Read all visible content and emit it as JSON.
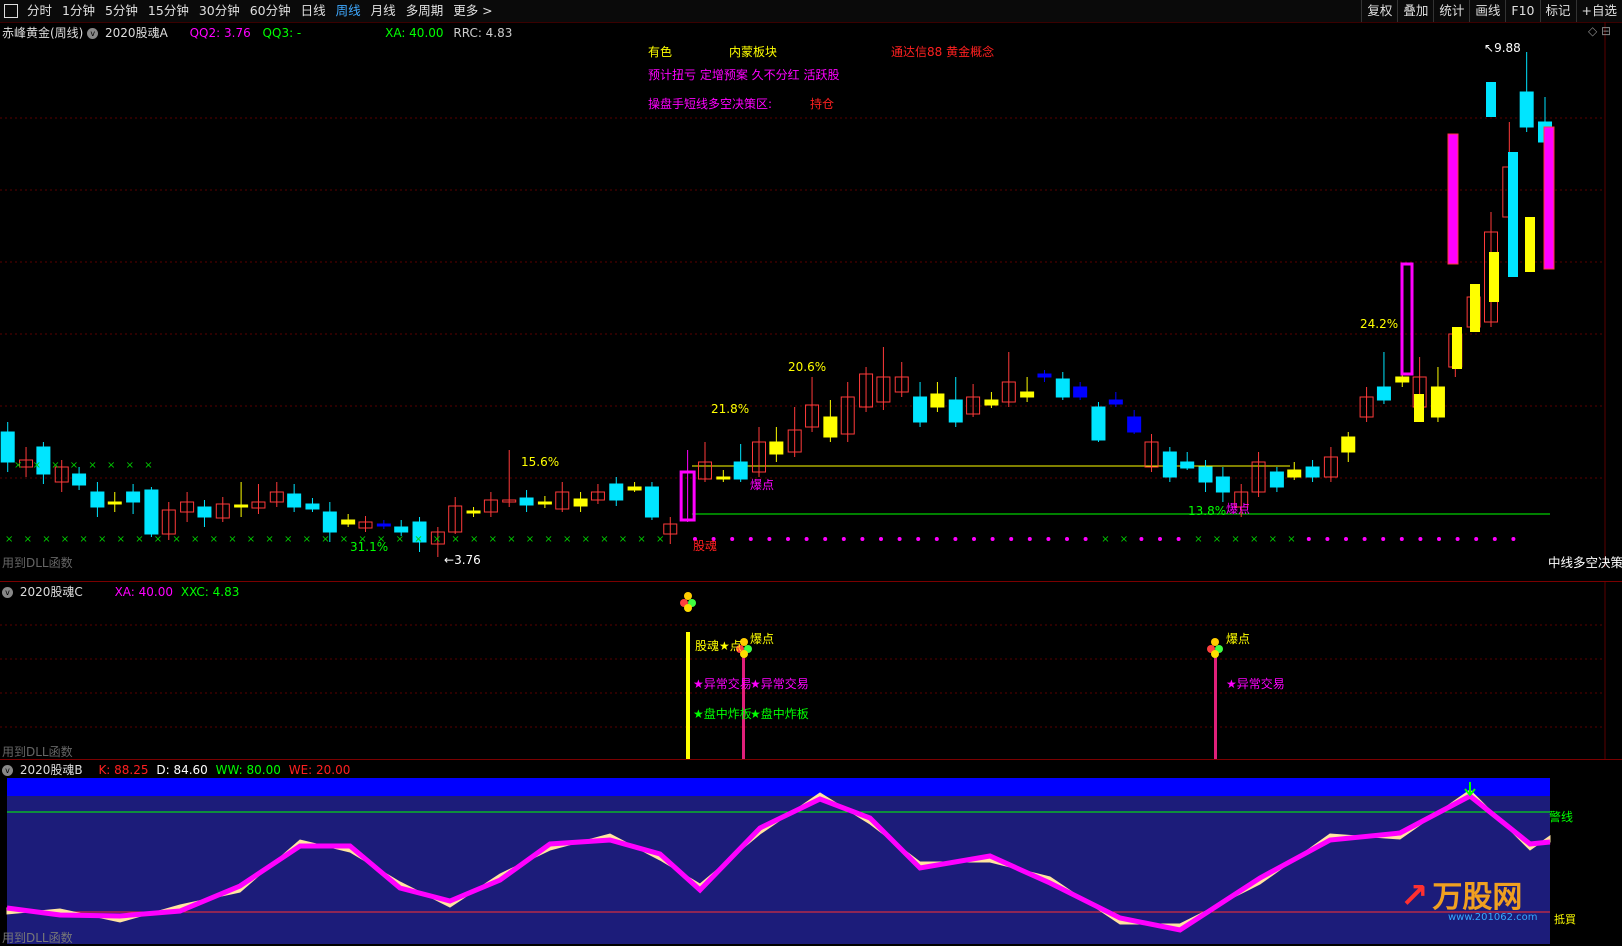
{
  "toolbar": {
    "periods": [
      "分时",
      "1分钟",
      "5分钟",
      "15分钟",
      "30分钟",
      "60分钟",
      "日线",
      "周线",
      "月线",
      "多周期",
      "更多 >"
    ],
    "active": "周线",
    "right": [
      "复权",
      "叠加",
      "统计",
      "画线",
      "F10",
      "标记",
      "+自选"
    ]
  },
  "main": {
    "stock": "赤峰黄金(周线)",
    "indicator": "2020股魂A",
    "qq2": "QQ2: 3.76",
    "qq3": "QQ3: -",
    "xa": "XA: 40.00",
    "rrc": "RRC: 4.83",
    "info": {
      "youse": "有色",
      "neimeng": "内蒙板块",
      "tongda": "通达信88 黄金概念",
      "line2": "预计扭亏 定增预案 久不分红 活跃股",
      "line3": "操盘手短线多空决策区:",
      "chicang": "持仓"
    },
    "labels": {
      "high": "9.88",
      "low": "3.76",
      "p1": "15.6%",
      "p2": "21.8%",
      "p3": "20.6%",
      "p4": "24.2%",
      "p5": "13.8%",
      "p6": "31.1%",
      "guhun": "股魂",
      "baodian1": "爆点",
      "baodian2": "爆点",
      "footer": "用到DLL函数",
      "zhongxian": "中线多空决策"
    }
  },
  "panelC": {
    "title": "2020股魂C",
    "xa": "XA: 40.00",
    "xxc": "XXC: 4.83",
    "guhun_star": "股魂★点",
    "baodian_a": "爆点",
    "baodian_b": "爆点",
    "yichang1": "★异常交易",
    "yichang2": "★异常交易",
    "yichang3": "★异常交易",
    "panzhong1": "★盘中炸板",
    "panzhong2": "★盘中炸板",
    "footer": "用到DLL函数"
  },
  "panelB": {
    "title": "2020股魂B",
    "k": "K: 88.25",
    "d": "D: 84.60",
    "ww": "WW: 80.00",
    "we": "WE: 20.00",
    "jingxian": "警线",
    "dimai": "抵買",
    "footer": "用到DLL函数"
  },
  "watermark": {
    "brand": "万股网",
    "url": "www.201062.com"
  },
  "colors": {
    "up": "#ff3a3a",
    "down": "#00e5ff",
    "yellow": "#ffff00",
    "blue": "#0000ff",
    "magenta": "#ff00ff",
    "green": "#00ff00",
    "panel_bg": "#1c1c7a"
  }
}
